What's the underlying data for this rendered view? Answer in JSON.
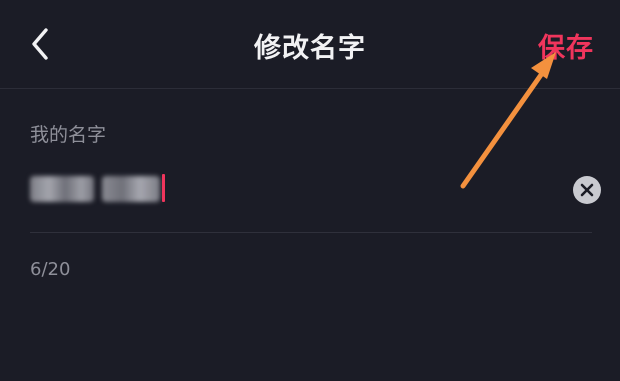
{
  "header": {
    "title": "修改名字",
    "save_label": "保存"
  },
  "form": {
    "field_label": "我的名字",
    "name_value_redacted": true,
    "char_count": "6/20"
  },
  "colors": {
    "background": "#1b1c26",
    "accent": "#f0355c",
    "annotation_arrow": "#f4913e",
    "text_primary": "#f2f2f4",
    "text_secondary": "#8e8f99"
  },
  "icons": {
    "back": "chevron-left-icon",
    "clear": "close-circle-icon",
    "annotation": "arrow-icon"
  }
}
